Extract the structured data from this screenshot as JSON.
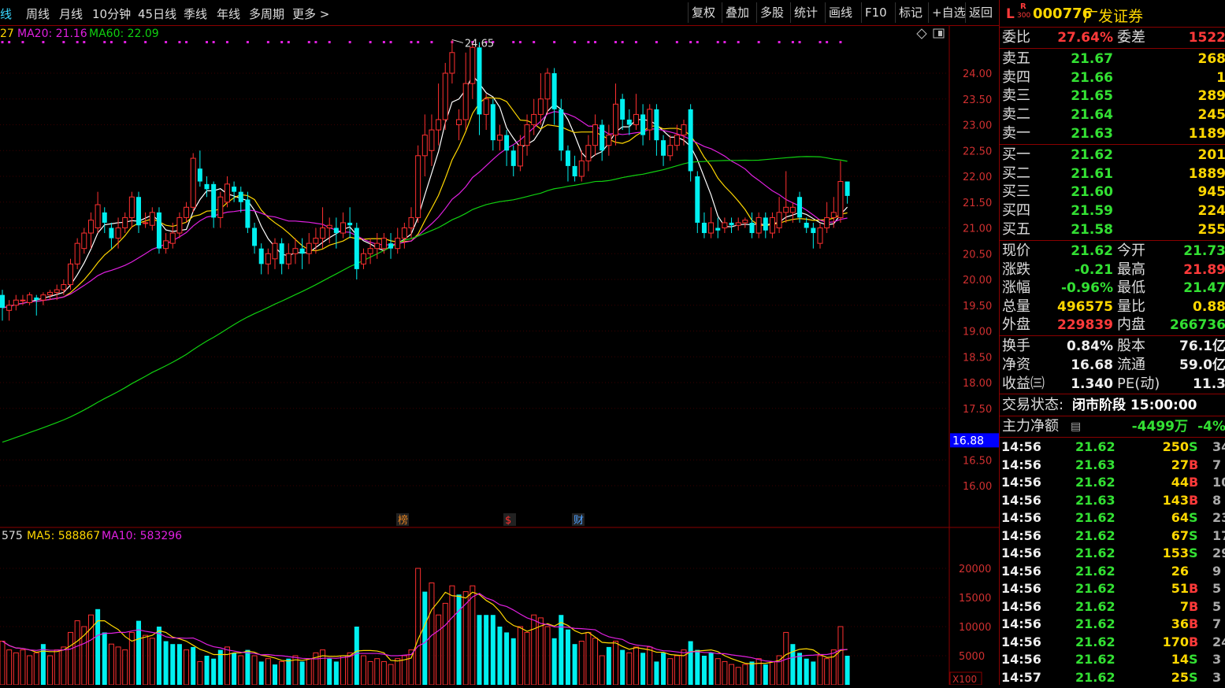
{
  "toolbar": {
    "periods": [
      {
        "label": "日线",
        "display": "线",
        "active": true
      },
      {
        "label": "周线",
        "active": false
      },
      {
        "label": "月线",
        "active": false
      },
      {
        "label": "10分钟",
        "active": false
      },
      {
        "label": "45日线",
        "active": false
      },
      {
        "label": "季线",
        "active": false
      },
      {
        "label": "年线",
        "active": false
      },
      {
        "label": "多周期",
        "active": false
      },
      {
        "label": "更多 >",
        "active": false
      }
    ],
    "buttons": [
      "复权",
      "叠加",
      "多股",
      "统计",
      "画线",
      "F10",
      "标记",
      "+自选",
      "返回"
    ]
  },
  "legend": {
    "ma_prefix": "27",
    "ma20": "MA20: 21.16",
    "ma60": "MA60: 22.09",
    "vol_prefix": "575",
    "vol_ma5": "MA5: 588867",
    "vol_ma10": "MA10: 583296"
  },
  "chart_data": {
    "type": "candlestick",
    "price_axis": {
      "ticks": [
        "24.00",
        "23.50",
        "23.00",
        "22.50",
        "22.00",
        "21.50",
        "21.00",
        "20.50",
        "20.00",
        "19.50",
        "19.00",
        "18.50",
        "18.00",
        "17.50",
        "16.88",
        "16.50",
        "16.00"
      ],
      "current_marker": "16.88"
    },
    "volume_axis": {
      "ticks": [
        "20000",
        "15000",
        "10000",
        "5000"
      ],
      "unit": "X100"
    },
    "high_annotation": "24.65",
    "event_markers": [
      "榜",
      "$",
      "财"
    ],
    "colors": {
      "up": "#ff3030",
      "down": "#00f0f0",
      "ma5": "#ffffff",
      "ma10": "#ffd700",
      "ma20": "#e020e0",
      "ma60": "#10d010"
    },
    "candles": [
      [
        19.7,
        19.45,
        19.2,
        19.8
      ],
      [
        19.4,
        19.5,
        19.2,
        19.6
      ],
      [
        19.5,
        19.6,
        19.4,
        19.7
      ],
      [
        19.6,
        19.6,
        19.5,
        19.7
      ],
      [
        19.55,
        19.7,
        19.5,
        19.75
      ],
      [
        19.65,
        19.6,
        19.3,
        19.7
      ],
      [
        19.6,
        19.7,
        19.5,
        19.75
      ],
      [
        19.7,
        19.75,
        19.6,
        19.8
      ],
      [
        19.75,
        19.8,
        19.6,
        19.9
      ],
      [
        19.8,
        19.9,
        19.7,
        20.0
      ],
      [
        19.9,
        20.3,
        19.8,
        20.4
      ],
      [
        20.3,
        20.7,
        20.2,
        20.8
      ],
      [
        20.6,
        20.9,
        20.5,
        21.0
      ],
      [
        20.9,
        21.15,
        20.6,
        21.3
      ],
      [
        21.0,
        21.45,
        20.9,
        21.7
      ],
      [
        21.3,
        21.1,
        20.9,
        21.4
      ],
      [
        21.0,
        20.8,
        20.6,
        21.1
      ],
      [
        20.8,
        21.0,
        20.6,
        21.2
      ],
      [
        21.0,
        21.2,
        20.9,
        21.3
      ],
      [
        21.2,
        21.6,
        21.0,
        21.7
      ],
      [
        21.6,
        21.05,
        20.9,
        21.7
      ],
      [
        21.1,
        21.1,
        21.0,
        21.3
      ],
      [
        21.05,
        21.3,
        20.95,
        21.4
      ],
      [
        21.3,
        20.6,
        20.5,
        21.4
      ],
      [
        20.6,
        20.75,
        20.5,
        20.9
      ],
      [
        20.7,
        20.9,
        20.6,
        21.1
      ],
      [
        20.9,
        21.2,
        20.8,
        21.3
      ],
      [
        21.2,
        21.4,
        21.1,
        21.5
      ],
      [
        21.4,
        22.35,
        21.3,
        22.45
      ],
      [
        22.15,
        21.9,
        21.8,
        22.5
      ],
      [
        21.85,
        21.75,
        21.6,
        22.0
      ],
      [
        21.85,
        21.2,
        21.0,
        21.9
      ],
      [
        21.2,
        21.6,
        21.0,
        21.7
      ],
      [
        21.5,
        21.85,
        21.4,
        22.0
      ],
      [
        21.8,
        21.7,
        21.5,
        21.9
      ],
      [
        21.7,
        21.5,
        21.3,
        21.8
      ],
      [
        21.55,
        21.0,
        20.9,
        21.7
      ],
      [
        21.0,
        20.65,
        20.5,
        21.1
      ],
      [
        20.6,
        20.3,
        20.1,
        20.7
      ],
      [
        20.3,
        20.5,
        20.1,
        20.6
      ],
      [
        20.4,
        20.7,
        20.2,
        20.8
      ],
      [
        20.7,
        20.3,
        20.1,
        20.8
      ],
      [
        20.3,
        20.5,
        20.2,
        20.7
      ],
      [
        20.5,
        20.6,
        20.3,
        20.8
      ],
      [
        20.6,
        20.5,
        20.2,
        20.8
      ],
      [
        20.5,
        20.7,
        20.3,
        20.9
      ],
      [
        20.7,
        20.8,
        20.5,
        21.0
      ],
      [
        20.8,
        21.0,
        20.6,
        21.4
      ],
      [
        21.0,
        21.05,
        20.7,
        21.2
      ],
      [
        21.0,
        20.9,
        20.6,
        21.2
      ],
      [
        20.9,
        21.1,
        20.8,
        21.3
      ],
      [
        21.1,
        21.05,
        20.8,
        21.4
      ],
      [
        21.0,
        20.2,
        20.0,
        21.1
      ],
      [
        20.3,
        20.5,
        20.2,
        20.6
      ],
      [
        20.5,
        20.6,
        20.3,
        20.8
      ],
      [
        20.6,
        20.7,
        20.4,
        20.9
      ],
      [
        20.6,
        20.8,
        20.5,
        20.9
      ],
      [
        20.7,
        20.6,
        20.4,
        20.9
      ],
      [
        20.6,
        20.8,
        20.5,
        21.0
      ],
      [
        20.8,
        21.0,
        20.6,
        21.1
      ],
      [
        21.0,
        21.2,
        20.8,
        21.4
      ],
      [
        21.2,
        22.4,
        21.1,
        22.6
      ],
      [
        22.4,
        22.8,
        22.0,
        23.2
      ],
      [
        22.5,
        22.9,
        22.2,
        23.2
      ],
      [
        22.9,
        23.1,
        22.6,
        23.8
      ],
      [
        23.1,
        24.0,
        22.9,
        24.2
      ],
      [
        24.0,
        24.4,
        23.8,
        24.65
      ],
      [
        23.0,
        23.1,
        22.7,
        23.3
      ],
      [
        23.1,
        23.8,
        22.9,
        24.4
      ],
      [
        23.8,
        24.5,
        23.5,
        24.6
      ],
      [
        24.5,
        23.2,
        22.8,
        24.6
      ],
      [
        23.2,
        23.5,
        22.9,
        23.6
      ],
      [
        23.4,
        22.7,
        22.5,
        23.5
      ],
      [
        22.7,
        22.8,
        22.5,
        23.0
      ],
      [
        22.8,
        22.5,
        22.2,
        22.9
      ],
      [
        22.5,
        22.2,
        22.0,
        22.6
      ],
      [
        22.2,
        22.6,
        22.1,
        22.8
      ],
      [
        22.6,
        23.0,
        22.4,
        23.2
      ],
      [
        23.0,
        23.2,
        22.8,
        23.5
      ],
      [
        23.2,
        23.5,
        23.0,
        24.0
      ],
      [
        23.5,
        24.0,
        23.2,
        24.1
      ],
      [
        24.0,
        23.3,
        23.0,
        24.1
      ],
      [
        23.3,
        22.5,
        22.3,
        23.5
      ],
      [
        22.5,
        22.2,
        21.9,
        22.6
      ],
      [
        22.2,
        22.0,
        21.9,
        22.4
      ],
      [
        22.0,
        22.3,
        21.9,
        22.5
      ],
      [
        22.3,
        22.6,
        22.1,
        22.8
      ],
      [
        22.6,
        23.0,
        22.4,
        23.2
      ],
      [
        23.0,
        22.5,
        22.3,
        23.1
      ],
      [
        22.6,
        22.8,
        22.4,
        23.0
      ],
      [
        22.8,
        23.4,
        22.6,
        23.8
      ],
      [
        23.5,
        23.1,
        22.9,
        23.6
      ],
      [
        23.1,
        23.0,
        22.8,
        23.3
      ],
      [
        23.0,
        23.2,
        22.9,
        23.6
      ],
      [
        23.2,
        22.8,
        22.6,
        23.4
      ],
      [
        22.9,
        23.3,
        22.7,
        23.4
      ],
      [
        23.3,
        22.7,
        22.4,
        23.4
      ],
      [
        22.7,
        22.4,
        22.2,
        22.8
      ],
      [
        22.4,
        22.6,
        22.3,
        22.8
      ],
      [
        22.6,
        22.8,
        22.5,
        23.0
      ],
      [
        22.8,
        23.0,
        22.6,
        23.1
      ],
      [
        23.3,
        22.1,
        21.9,
        23.4
      ],
      [
        22.0,
        21.1,
        20.9,
        22.1
      ],
      [
        21.1,
        20.9,
        20.8,
        21.3
      ],
      [
        20.9,
        21.1,
        20.8,
        21.4
      ],
      [
        21.0,
        20.95,
        20.8,
        21.2
      ],
      [
        21.0,
        21.1,
        20.9,
        21.2
      ],
      [
        21.1,
        21.05,
        20.9,
        21.2
      ],
      [
        21.05,
        21.1,
        20.95,
        21.2
      ],
      [
        21.1,
        21.15,
        21.0,
        21.2
      ],
      [
        21.1,
        20.9,
        20.8,
        21.3
      ],
      [
        20.9,
        21.2,
        20.8,
        21.3
      ],
      [
        21.2,
        20.95,
        20.8,
        21.3
      ],
      [
        20.9,
        21.2,
        20.8,
        21.3
      ],
      [
        21.0,
        21.3,
        20.9,
        21.6
      ],
      [
        21.3,
        21.4,
        21.1,
        22.1
      ],
      [
        21.3,
        21.4,
        21.1,
        21.5
      ],
      [
        21.6,
        21.2,
        21.1,
        21.7
      ],
      [
        21.1,
        21.0,
        20.9,
        21.2
      ],
      [
        21.0,
        20.9,
        20.6,
        21.1
      ],
      [
        20.7,
        21.0,
        20.6,
        21.1
      ],
      [
        21.0,
        21.2,
        20.9,
        21.5
      ],
      [
        21.2,
        21.3,
        21.0,
        21.6
      ],
      [
        21.2,
        21.9,
        21.1,
        22.3
      ],
      [
        21.9,
        21.62,
        21.47,
        21.89
      ]
    ],
    "volumes": [
      [
        7500,
        1
      ],
      [
        6000,
        1
      ],
      [
        5500,
        1
      ],
      [
        6000,
        1
      ],
      [
        5000,
        1
      ],
      [
        5500,
        1
      ],
      [
        7000,
        0
      ],
      [
        5000,
        1
      ],
      [
        6000,
        1
      ],
      [
        6500,
        1
      ],
      [
        9000,
        1
      ],
      [
        11000,
        1
      ],
      [
        10000,
        1
      ],
      [
        12000,
        1
      ],
      [
        13000,
        0
      ],
      [
        9000,
        0
      ],
      [
        7000,
        1
      ],
      [
        6500,
        1
      ],
      [
        6000,
        1
      ],
      [
        9000,
        1
      ],
      [
        11000,
        0
      ],
      [
        8500,
        1
      ],
      [
        8000,
        1
      ],
      [
        10000,
        0
      ],
      [
        7500,
        0
      ],
      [
        7000,
        0
      ],
      [
        7000,
        0
      ],
      [
        6000,
        1
      ],
      [
        6500,
        0
      ],
      [
        4000,
        1
      ],
      [
        5000,
        0
      ],
      [
        4500,
        0
      ],
      [
        6000,
        0
      ],
      [
        6500,
        1
      ],
      [
        5500,
        0
      ],
      [
        5000,
        1
      ],
      [
        6000,
        0
      ],
      [
        5000,
        1
      ],
      [
        4000,
        0
      ],
      [
        4500,
        1
      ],
      [
        3500,
        0
      ],
      [
        4000,
        1
      ],
      [
        4500,
        0
      ],
      [
        5000,
        1
      ],
      [
        4000,
        0
      ],
      [
        4500,
        1
      ],
      [
        5500,
        1
      ],
      [
        6000,
        1
      ],
      [
        4500,
        0
      ],
      [
        4000,
        0
      ],
      [
        5000,
        1
      ],
      [
        5500,
        1
      ],
      [
        10000,
        0
      ],
      [
        5000,
        1
      ],
      [
        4000,
        1
      ],
      [
        4500,
        1
      ],
      [
        4000,
        1
      ],
      [
        3500,
        1
      ],
      [
        4500,
        1
      ],
      [
        5000,
        1
      ],
      [
        6000,
        1
      ],
      [
        20000,
        1
      ],
      [
        16000,
        0
      ],
      [
        17500,
        1
      ],
      [
        12000,
        1
      ],
      [
        14000,
        1
      ],
      [
        17000,
        1
      ],
      [
        15500,
        0
      ],
      [
        16000,
        1
      ],
      [
        17000,
        1
      ],
      [
        12000,
        0
      ],
      [
        12000,
        0
      ],
      [
        12000,
        0
      ],
      [
        10000,
        0
      ],
      [
        9000,
        0
      ],
      [
        8000,
        0
      ],
      [
        10000,
        1
      ],
      [
        9000,
        1
      ],
      [
        12000,
        1
      ],
      [
        11500,
        1
      ],
      [
        10000,
        1
      ],
      [
        8000,
        0
      ],
      [
        12000,
        0
      ],
      [
        9500,
        0
      ],
      [
        7000,
        0
      ],
      [
        7500,
        1
      ],
      [
        9000,
        1
      ],
      [
        8000,
        1
      ],
      [
        5000,
        1
      ],
      [
        6500,
        0
      ],
      [
        7500,
        1
      ],
      [
        6000,
        0
      ],
      [
        5500,
        1
      ],
      [
        6500,
        1
      ],
      [
        5500,
        0
      ],
      [
        6500,
        1
      ],
      [
        4000,
        0
      ],
      [
        5500,
        0
      ],
      [
        4500,
        1
      ],
      [
        5000,
        1
      ],
      [
        6000,
        1
      ],
      [
        7500,
        0
      ],
      [
        6000,
        0
      ],
      [
        5000,
        0
      ],
      [
        5500,
        0
      ],
      [
        4500,
        1
      ],
      [
        4000,
        1
      ],
      [
        3500,
        1
      ],
      [
        3000,
        1
      ],
      [
        3500,
        1
      ],
      [
        4000,
        0
      ],
      [
        4500,
        1
      ],
      [
        3500,
        0
      ],
      [
        4000,
        1
      ],
      [
        5000,
        1
      ],
      [
        9000,
        1
      ],
      [
        7000,
        0
      ],
      [
        5500,
        0
      ],
      [
        4500,
        0
      ],
      [
        4000,
        0
      ],
      [
        5000,
        1
      ],
      [
        4500,
        1
      ],
      [
        6000,
        1
      ],
      [
        10000,
        1
      ],
      [
        5000,
        0
      ]
    ]
  },
  "stock": {
    "tag_l": "L",
    "tag_r": "R",
    "tag_300": "300",
    "code": "000776",
    "name": "广发证券"
  },
  "order_book": {
    "weibi": {
      "label": "委比",
      "value": "27.64%"
    },
    "weicha": {
      "label": "委差",
      "value": "1522"
    },
    "sells": [
      {
        "label": "卖五",
        "price": "21.67",
        "vol": "268"
      },
      {
        "label": "卖四",
        "price": "21.66",
        "vol": "1"
      },
      {
        "label": "卖三",
        "price": "21.65",
        "vol": "289"
      },
      {
        "label": "卖二",
        "price": "21.64",
        "vol": "245"
      },
      {
        "label": "卖一",
        "price": "21.63",
        "vol": "1189"
      }
    ],
    "buys": [
      {
        "label": "买一",
        "price": "21.62",
        "vol": "201"
      },
      {
        "label": "买二",
        "price": "21.61",
        "vol": "1889"
      },
      {
        "label": "买三",
        "price": "21.60",
        "vol": "945"
      },
      {
        "label": "买四",
        "price": "21.59",
        "vol": "224"
      },
      {
        "label": "买五",
        "price": "21.58",
        "vol": "255"
      }
    ]
  },
  "quote": [
    {
      "l1": "现价",
      "v1": "21.62",
      "c1": "g",
      "l2": "今开",
      "v2": "21.73",
      "c2": "g"
    },
    {
      "l1": "涨跌",
      "v1": "-0.21",
      "c1": "g",
      "l2": "最高",
      "v2": "21.89",
      "c2": "r"
    },
    {
      "l1": "涨幅",
      "v1": "-0.96%",
      "c1": "g",
      "l2": "最低",
      "v2": "21.47",
      "c2": "g"
    },
    {
      "l1": "总量",
      "v1": "496575",
      "c1": "y",
      "l2": "量比",
      "v2": "0.88",
      "c2": "y"
    },
    {
      "l1": "外盘",
      "v1": "229839",
      "c1": "r",
      "l2": "内盘",
      "v2": "266736",
      "c2": "g"
    }
  ],
  "fundamentals": [
    {
      "l1": "换手",
      "v1": "0.84%",
      "l2": "股本",
      "v2": "76.1亿"
    },
    {
      "l1": "净资",
      "v1": "16.68",
      "l2": "流通",
      "v2": "59.0亿"
    },
    {
      "l1": "收益(三)",
      "display1": "收益㈢",
      "v1": "1.340",
      "l2": "PE(动)",
      "v2": "11.3"
    }
  ],
  "status": {
    "label": "交易状态:",
    "value": "闭市阶段 15:00:00"
  },
  "main_flow": {
    "label": "主力净额",
    "value": "-4499万",
    "pct": "-4%"
  },
  "ticks": [
    {
      "time": "14:56",
      "price": "21.62",
      "vol": "250",
      "bs": "S",
      "n": "34"
    },
    {
      "time": "14:56",
      "price": "21.63",
      "vol": "27",
      "bs": "B",
      "n": "7"
    },
    {
      "time": "14:56",
      "price": "21.62",
      "vol": "44",
      "bs": "B",
      "n": "10"
    },
    {
      "time": "14:56",
      "price": "21.63",
      "vol": "143",
      "bs": "B",
      "n": "8"
    },
    {
      "time": "14:56",
      "price": "21.62",
      "vol": "64",
      "bs": "S",
      "n": "23"
    },
    {
      "time": "14:56",
      "price": "21.62",
      "vol": "67",
      "bs": "S",
      "n": "17"
    },
    {
      "time": "14:56",
      "price": "21.62",
      "vol": "153",
      "bs": "S",
      "n": "29"
    },
    {
      "time": "14:56",
      "price": "21.62",
      "vol": "26",
      "bs": "",
      "n": "9"
    },
    {
      "time": "14:56",
      "price": "21.62",
      "vol": "51",
      "bs": "B",
      "n": "5"
    },
    {
      "time": "14:56",
      "price": "21.62",
      "vol": "7",
      "bs": "B",
      "n": "5"
    },
    {
      "time": "14:56",
      "price": "21.62",
      "vol": "36",
      "bs": "B",
      "n": "7"
    },
    {
      "time": "14:56",
      "price": "21.62",
      "vol": "170",
      "bs": "B",
      "n": "24"
    },
    {
      "time": "14:56",
      "price": "21.62",
      "vol": "14",
      "bs": "S",
      "n": "3"
    },
    {
      "time": "14:57",
      "price": "21.62",
      "vol": "25",
      "bs": "S",
      "n": "3"
    }
  ]
}
